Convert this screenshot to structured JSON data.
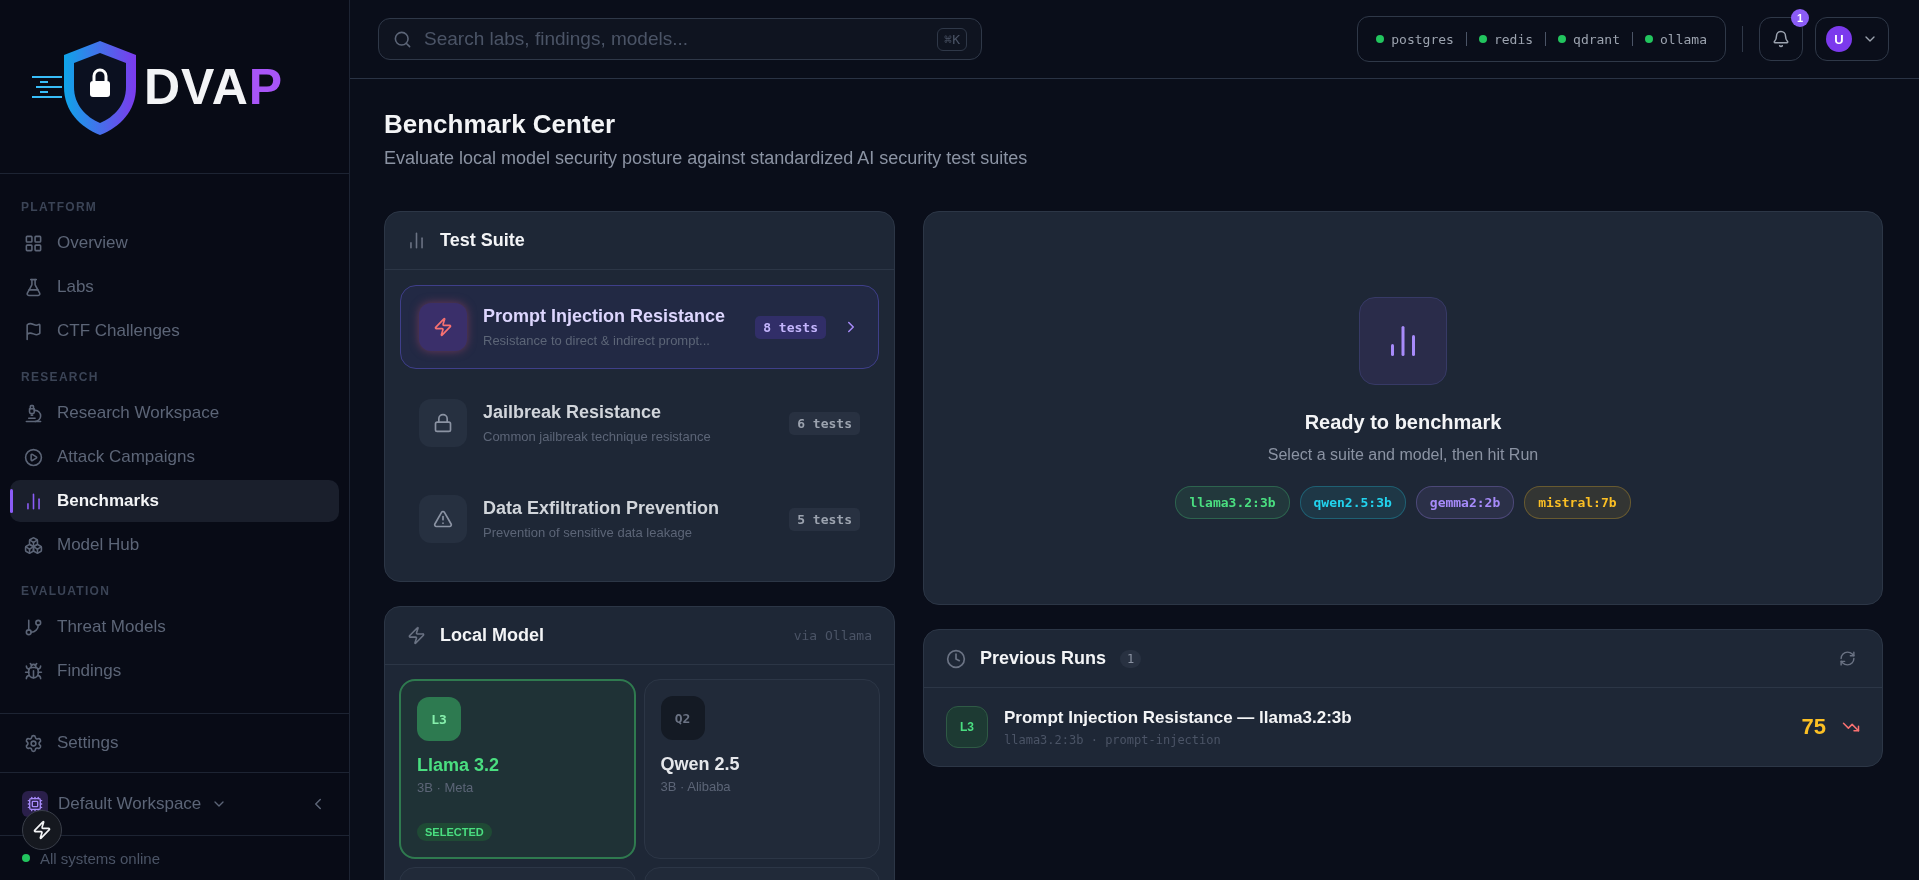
{
  "logo": {
    "parts": [
      {
        "text": "DVA",
        "kind": "plain"
      },
      {
        "text": "P",
        "kind": "accent"
      }
    ]
  },
  "sidebar": {
    "sections": [
      {
        "title": "PLATFORM",
        "items": [
          {
            "label": "Overview",
            "selected": false
          },
          {
            "label": "Labs",
            "selected": false
          },
          {
            "label": "CTF Challenges",
            "selected": false
          }
        ]
      },
      {
        "title": "RESEARCH",
        "items": [
          {
            "label": "Research Workspace",
            "selected": false
          },
          {
            "label": "Attack Campaigns",
            "selected": false
          },
          {
            "label": "Benchmarks",
            "selected": true
          },
          {
            "label": "Model Hub",
            "selected": false
          }
        ]
      },
      {
        "title": "EVALUATION",
        "items": [
          {
            "label": "Threat Models",
            "selected": false
          },
          {
            "label": "Findings",
            "selected": false
          }
        ]
      }
    ],
    "settings": {
      "label": "Settings"
    },
    "workspace": {
      "label": "Default Workspace"
    },
    "status": {
      "text": "All systems online",
      "online": true
    }
  },
  "header": {
    "search": {
      "placeholder": "Search labs, findings, models...",
      "shortcut": "⌘K"
    },
    "services": [
      {
        "name": "postgres",
        "online": true
      },
      {
        "name": "redis",
        "online": true
      },
      {
        "name": "qdrant",
        "online": true
      },
      {
        "name": "ollama",
        "online": true
      }
    ],
    "notifications": "1",
    "avatar": "U"
  },
  "page": {
    "title": "Benchmark Center",
    "subtitle": "Evaluate local model security posture against standardized AI security test suites"
  },
  "test_suite": {
    "title": "Test Suite",
    "suites": [
      {
        "name": "Prompt Injection Resistance",
        "description": "Resistance to direct & indirect prompt...",
        "tests": "8 tests",
        "selected": true
      },
      {
        "name": "Jailbreak Resistance",
        "description": "Common jailbreak technique resistance",
        "tests": "6 tests",
        "selected": false
      },
      {
        "name": "Data Exfiltration Prevention",
        "description": "Prevention of sensitive data leakage",
        "tests": "5 tests",
        "selected": false
      }
    ]
  },
  "local_model": {
    "title": "Local Model",
    "source": "via Ollama",
    "models": [
      {
        "badge": "L3",
        "name": "Llama 3.2",
        "meta": "3B · Meta",
        "selected": true,
        "selected_label": "SELECTED"
      },
      {
        "badge": "Q2",
        "name": "Qwen 2.5",
        "meta": "3B · Alibaba",
        "selected": false
      },
      {
        "selected": false
      },
      {
        "selected": false
      }
    ]
  },
  "ready": {
    "title": "Ready to benchmark",
    "subtitle": "Select a suite and model, then hit Run",
    "chips": [
      {
        "label": "llama3.2:3b",
        "color": "#4ade80"
      },
      {
        "label": "qwen2.5:3b",
        "color": "#22d3ee"
      },
      {
        "label": "gemma2:2b",
        "color": "#a78bfa"
      },
      {
        "label": "mistral:7b",
        "color": "#fbbf24"
      }
    ]
  },
  "previous_runs": {
    "title": "Previous Runs",
    "count": "1",
    "runs": [
      {
        "badge": "L3",
        "title": "Prompt Injection Resistance — llama3.2:3b",
        "meta": "llama3.2:3b · prompt-injection",
        "score": "75",
        "kind": "down"
      }
    ]
  }
}
